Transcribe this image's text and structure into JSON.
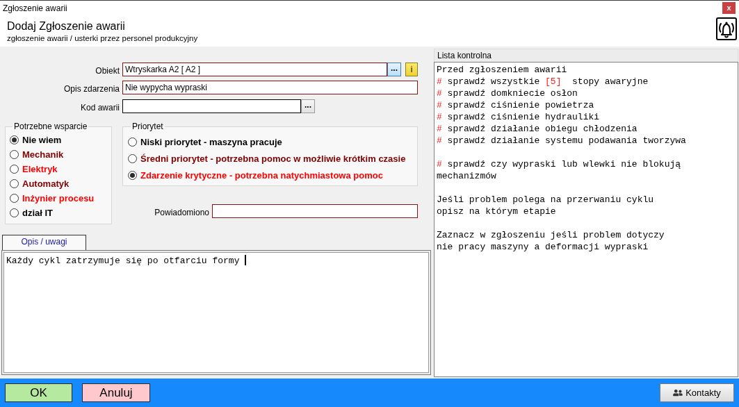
{
  "window": {
    "title": "Zgłoszenie awarii",
    "close_label": "x"
  },
  "header": {
    "title": "Dodaj Zgłoszenie awarii",
    "subtitle": "zgłoszenie awarii / usterki przez personel produkcyjny"
  },
  "object_field": {
    "label": "Obiekt",
    "value": "Wtryskarka A2 [ A2 ]",
    "required": true,
    "lookup_button": {
      "label": "...",
      "highlighted": true
    },
    "info_button": {
      "label": "i"
    }
  },
  "description_field": {
    "label": "Opis zdarzenia",
    "value": "Nie wypycha wypraski",
    "required": true
  },
  "code_field": {
    "label": "Kod awarii",
    "required": false,
    "lookup_button": {
      "label": "...",
      "highlighted": false
    }
  },
  "support_group": {
    "title": "Potrzebne wsparcie",
    "options": [
      {
        "label": "Nie wiem",
        "selected": true,
        "color": "#000000"
      },
      {
        "label": "Mechanik",
        "selected": false,
        "color": "#800000"
      },
      {
        "label": "Elektryk",
        "selected": false,
        "color": "#ff0000"
      },
      {
        "label": "Automatyk",
        "selected": false,
        "color": "#800000"
      },
      {
        "label": "Inżynier procesu",
        "selected": false,
        "color": "#ff0000"
      },
      {
        "label": "dział IT",
        "selected": false,
        "color": "#000000"
      }
    ]
  },
  "priority_group": {
    "title": "Priorytet",
    "options": [
      {
        "label": "Niski priorytet - maszyna pracuje",
        "selected": false,
        "color": "#000000"
      },
      {
        "label": "Średni priorytet - potrzebna pomoc w możliwie krótkim czasie",
        "selected": false,
        "color": "#800000"
      },
      {
        "label": "Zdarzenie krytyczne - potrzebna natychmiastowa pomoc",
        "selected": true,
        "color": "#ff0000"
      }
    ]
  },
  "notified_field": {
    "label": "Powiadomiono",
    "required": true
  },
  "notes": {
    "tabs": [
      {
        "label": "Opis / uwagi",
        "selected": true
      }
    ],
    "text": "Każdy cykl zatrzymuje się po otfarciu formy",
    "focused": true
  },
  "checklist": {
    "title": "Lista kontrolna",
    "paragraphs": [
      {
        "lines": [
          {
            "segments": [
              {
                "kind": "plain",
                "text": "Przed zgłoszeniem awarii"
              }
            ]
          },
          {
            "segments": [
              {
                "kind": "marker",
                "text": "#"
              },
              {
                "kind": "plain",
                "text": " sprawdź wszystkie "
              },
              {
                "kind": "marker",
                "text": "[5]"
              },
              {
                "kind": "plain",
                "text": "  stopy awaryjne"
              }
            ]
          },
          {
            "segments": [
              {
                "kind": "marker",
                "text": "#"
              },
              {
                "kind": "plain",
                "text": " sprawdź domkniecie osłon"
              }
            ]
          },
          {
            "segments": [
              {
                "kind": "marker",
                "text": "#"
              },
              {
                "kind": "plain",
                "text": " sprawdź ciśnienie powietrza"
              }
            ]
          },
          {
            "segments": [
              {
                "kind": "marker",
                "text": "#"
              },
              {
                "kind": "plain",
                "text": " sprawdź ciśnienie hydrauliki"
              }
            ]
          },
          {
            "segments": [
              {
                "kind": "marker",
                "text": "#"
              },
              {
                "kind": "plain",
                "text": " sprawdź działanie obiegu chłodzenia"
              }
            ]
          },
          {
            "segments": [
              {
                "kind": "marker",
                "text": "#"
              },
              {
                "kind": "plain",
                "text": " sprawdź działanie systemu podawania tworzywa"
              }
            ]
          }
        ]
      },
      {
        "lines": [
          {
            "segments": [
              {
                "kind": "marker",
                "text": "#"
              },
              {
                "kind": "plain",
                "text": " sprawdź czy wypraski lub wlewki nie blokują"
              }
            ]
          },
          {
            "segments": [
              {
                "kind": "plain",
                "text": "mechanizmów"
              }
            ]
          }
        ]
      },
      {
        "lines": [
          {
            "segments": [
              {
                "kind": "plain",
                "text": "Jeśli problem polega na przerwaniu cyklu"
              }
            ]
          },
          {
            "segments": [
              {
                "kind": "plain",
                "text": "opisz na którym etapie"
              }
            ]
          }
        ]
      },
      {
        "lines": [
          {
            "segments": [
              {
                "kind": "plain",
                "text": "Zaznacz w zgłoszeniu jeśli problem dotyczy"
              }
            ]
          },
          {
            "segments": [
              {
                "kind": "plain",
                "text": "nie pracy maszyny a deformacji wypraski"
              }
            ]
          }
        ]
      }
    ]
  },
  "footer": {
    "buttons": [
      {
        "label": "OK",
        "kind": "confirm"
      },
      {
        "label": "Anuluj",
        "kind": "cancel"
      },
      {
        "label": "Kontakty",
        "kind": "contacts"
      }
    ]
  }
}
